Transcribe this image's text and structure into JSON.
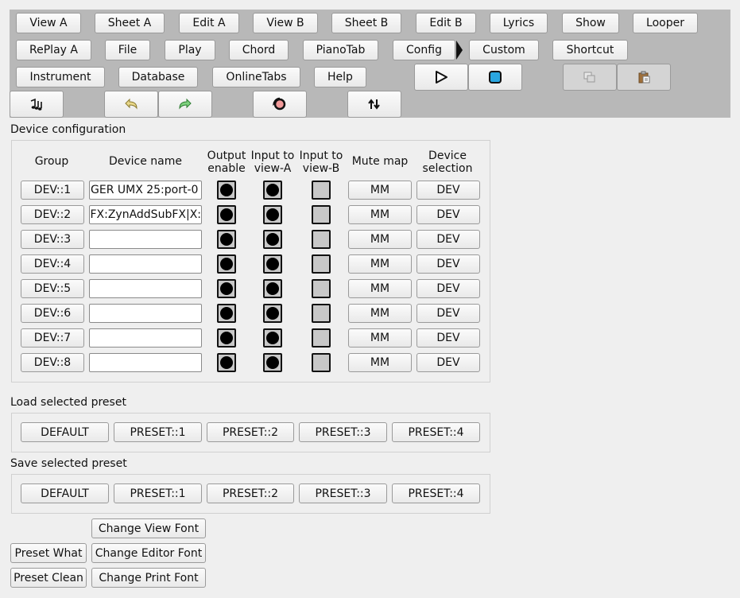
{
  "toolbar": {
    "row1": [
      "View A",
      "Sheet A",
      "Edit A",
      "View B",
      "Sheet B",
      "Edit B",
      "Lyrics",
      "Show",
      "Looper"
    ],
    "row2": [
      "RePlay A",
      "File",
      "Play",
      "Chord",
      "PianoTab",
      "Config",
      "Custom",
      "Shortcut"
    ],
    "row3": [
      "Instrument",
      "Database",
      "OnlineTabs",
      "Help"
    ],
    "icons": {
      "play": "play-icon",
      "stop": "stop-icon",
      "copy": "copy-icon",
      "paste": "paste-icon",
      "notes": "music-notes-icon",
      "undo": "undo-icon",
      "redo": "redo-icon",
      "record": "record-loop-icon",
      "swap": "swap-arrows-icon",
      "expand": "triangle-right-icon"
    }
  },
  "device_config": {
    "title": "Device configuration",
    "headers": {
      "group": "Group",
      "device_name": "Device name",
      "output_enable": [
        "Output",
        "enable"
      ],
      "input_a": [
        "Input to",
        "view-A"
      ],
      "input_b": [
        "Input to",
        "view-B"
      ],
      "mute_map": "Mute map",
      "device_selection": [
        "Device",
        "selection"
      ]
    },
    "rows": [
      {
        "group": "DEV::1",
        "name": "GER UMX 25:port-0",
        "output": true,
        "in_a": true,
        "in_b": false,
        "mm": "MM",
        "dev": "DEV"
      },
      {
        "group": "DEV::2",
        "name": "FX:ZynAddSubFX|X:",
        "output": true,
        "in_a": true,
        "in_b": false,
        "mm": "MM",
        "dev": "DEV"
      },
      {
        "group": "DEV::3",
        "name": "",
        "output": true,
        "in_a": true,
        "in_b": false,
        "mm": "MM",
        "dev": "DEV"
      },
      {
        "group": "DEV::4",
        "name": "",
        "output": true,
        "in_a": true,
        "in_b": false,
        "mm": "MM",
        "dev": "DEV"
      },
      {
        "group": "DEV::5",
        "name": "",
        "output": true,
        "in_a": true,
        "in_b": false,
        "mm": "MM",
        "dev": "DEV"
      },
      {
        "group": "DEV::6",
        "name": "",
        "output": true,
        "in_a": true,
        "in_b": false,
        "mm": "MM",
        "dev": "DEV"
      },
      {
        "group": "DEV::7",
        "name": "",
        "output": true,
        "in_a": true,
        "in_b": false,
        "mm": "MM",
        "dev": "DEV"
      },
      {
        "group": "DEV::8",
        "name": "",
        "output": true,
        "in_a": true,
        "in_b": false,
        "mm": "MM",
        "dev": "DEV"
      }
    ]
  },
  "load_preset": {
    "title": "Load selected preset",
    "buttons": [
      "DEFAULT",
      "PRESET::1",
      "PRESET::2",
      "PRESET::3",
      "PRESET::4"
    ]
  },
  "save_preset": {
    "title": "Save selected preset",
    "buttons": [
      "DEFAULT",
      "PRESET::1",
      "PRESET::2",
      "PRESET::3",
      "PRESET::4"
    ]
  },
  "bottom": {
    "change_view_font": "Change View Font",
    "preset_what": "Preset What",
    "change_editor_font": "Change Editor Font",
    "preset_clean": "Preset Clean",
    "change_print_font": "Change Print Font"
  },
  "colors": {
    "toolbar_bg": "#b8b8b8",
    "stop_fill": "#2aa6e0",
    "undo_color": "#c9b35a",
    "redo_color": "#4caf50"
  }
}
